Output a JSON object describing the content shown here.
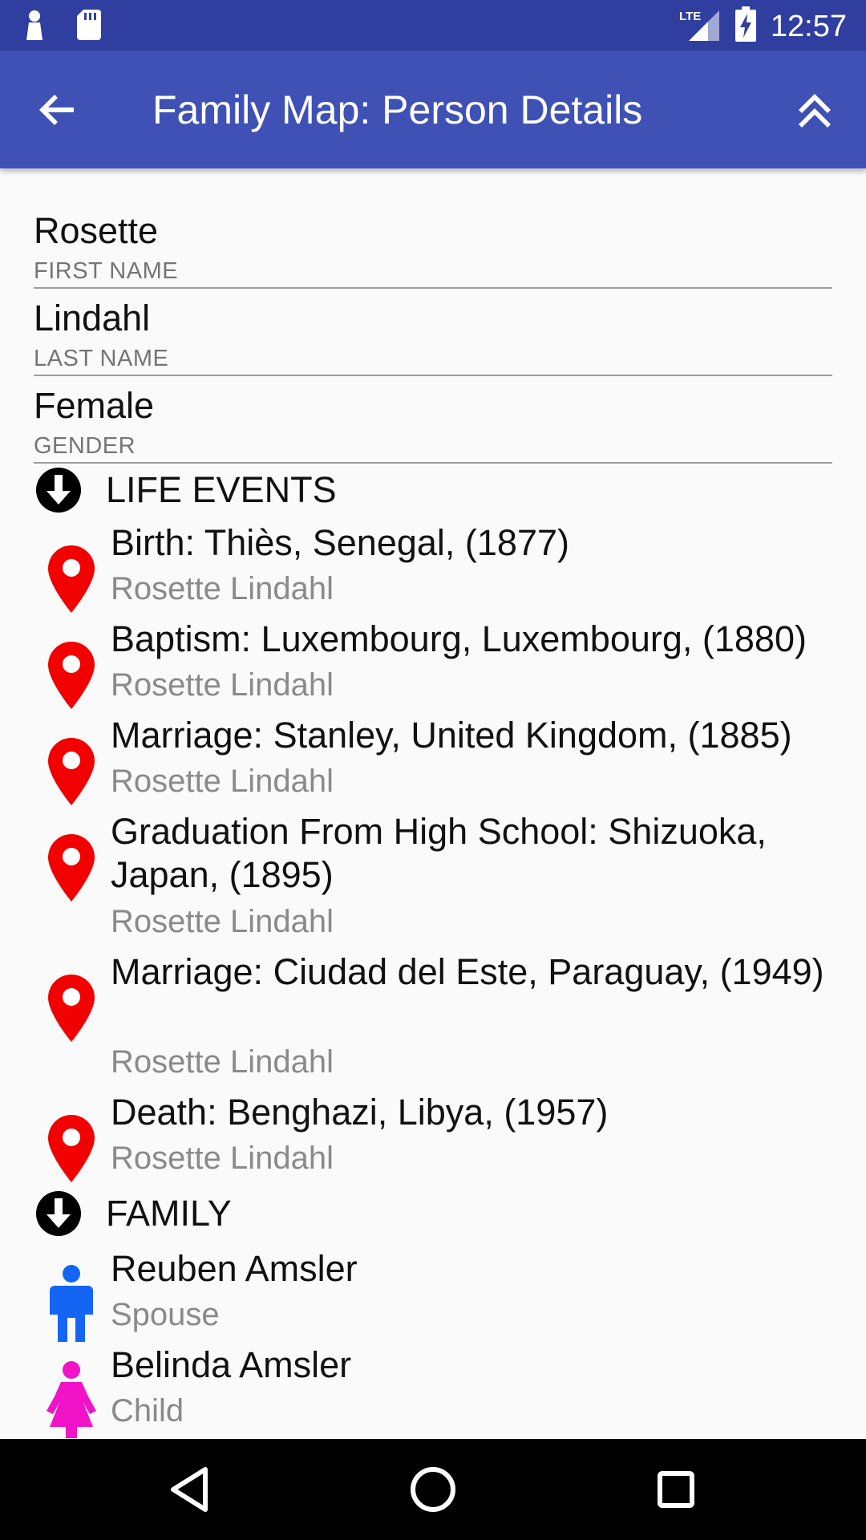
{
  "status_bar": {
    "time": "12:57",
    "network": "LTE",
    "icons": [
      "notification-icon",
      "sd-card-icon",
      "signal-icon",
      "battery-charging-icon"
    ]
  },
  "app_bar": {
    "title": "Family Map: Person Details",
    "back_icon": "arrow-back-icon",
    "up_icon": "double-chevron-up-icon"
  },
  "person": {
    "first_name": {
      "value": "Rosette",
      "label": "FIRST NAME"
    },
    "last_name": {
      "value": "Lindahl",
      "label": "LAST NAME"
    },
    "gender": {
      "value": "Female",
      "label": "GENDER"
    }
  },
  "life_events": {
    "header": "LIFE EVENTS",
    "items": [
      {
        "title": "Birth: Thiès, Senegal, (1877)",
        "person": "Rosette Lindahl"
      },
      {
        "title": "Baptism: Luxembourg, Luxembourg, (1880)",
        "person": "Rosette Lindahl"
      },
      {
        "title": "Marriage: Stanley, United Kingdom, (1885)",
        "person": "Rosette Lindahl"
      },
      {
        "title": "Graduation From High School: Shizuoka, Japan, (1895)",
        "person": "Rosette Lindahl"
      },
      {
        "title": "Marriage: Ciudad del Este, Paraguay, (1949)",
        "person": "Rosette Lindahl"
      },
      {
        "title": "Death: Benghazi, Libya, (1957)",
        "person": "Rosette Lindahl"
      }
    ]
  },
  "family": {
    "header": "FAMILY",
    "items": [
      {
        "name": "Reuben Amsler",
        "relation": "Spouse",
        "gender": "male"
      },
      {
        "name": "Belinda Amsler",
        "relation": "Child",
        "gender": "female"
      }
    ]
  },
  "colors": {
    "status_bar": "#303f9f",
    "app_bar": "#3f51b5",
    "event_pin": "#f20000",
    "male": "#1565f5",
    "female": "#f013c8"
  }
}
